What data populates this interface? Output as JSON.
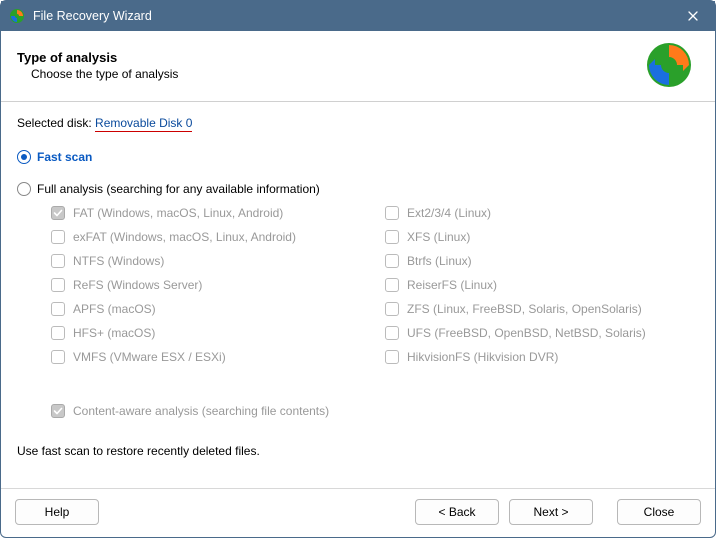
{
  "window": {
    "title": "File Recovery Wizard"
  },
  "header": {
    "title": "Type of analysis",
    "subtitle": "Choose the type of analysis"
  },
  "selected_disk": {
    "label": "Selected disk: ",
    "value": "Removable Disk 0"
  },
  "scan": {
    "fast_label": "Fast scan",
    "full_label": "Full analysis (searching for any available information)",
    "selected": "fast"
  },
  "filesystems": {
    "left": [
      {
        "id": "fat",
        "label": "FAT (Windows, macOS, Linux, Android)",
        "checked": true
      },
      {
        "id": "exfat",
        "label": "exFAT (Windows, macOS, Linux, Android)",
        "checked": false
      },
      {
        "id": "ntfs",
        "label": "NTFS (Windows)",
        "checked": false
      },
      {
        "id": "refs",
        "label": "ReFS (Windows Server)",
        "checked": false
      },
      {
        "id": "apfs",
        "label": "APFS (macOS)",
        "checked": false
      },
      {
        "id": "hfs",
        "label": "HFS+ (macOS)",
        "checked": false
      },
      {
        "id": "vmfs",
        "label": "VMFS (VMware ESX / ESXi)",
        "checked": false
      }
    ],
    "right": [
      {
        "id": "ext",
        "label": "Ext2/3/4 (Linux)",
        "checked": false
      },
      {
        "id": "xfs",
        "label": "XFS (Linux)",
        "checked": false
      },
      {
        "id": "btrfs",
        "label": "Btrfs (Linux)",
        "checked": false
      },
      {
        "id": "reiserfs",
        "label": "ReiserFS (Linux)",
        "checked": false
      },
      {
        "id": "zfs",
        "label": "ZFS (Linux, FreeBSD, Solaris, OpenSolaris)",
        "checked": false
      },
      {
        "id": "ufs",
        "label": "UFS (FreeBSD, OpenBSD, NetBSD, Solaris)",
        "checked": false
      },
      {
        "id": "hikfs",
        "label": "HikvisionFS (Hikvision DVR)",
        "checked": false
      }
    ]
  },
  "content_aware": {
    "label": "Content-aware analysis (searching file contents)",
    "checked": true
  },
  "hint": "Use fast scan to restore recently deleted files.",
  "buttons": {
    "help": "Help",
    "back": "< Back",
    "next": "Next >",
    "close": "Close"
  }
}
